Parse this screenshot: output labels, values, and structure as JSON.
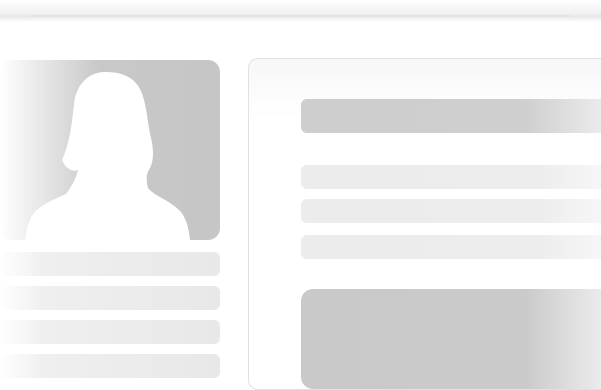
{
  "screen": {
    "type": "profile-page-skeleton",
    "icons": {
      "avatar": "person-silhouette-icon"
    },
    "colors": {
      "placeholder_dark": "#c8c8c8",
      "placeholder_light": "#ececec",
      "panel_border": "#e1e1e1"
    }
  }
}
